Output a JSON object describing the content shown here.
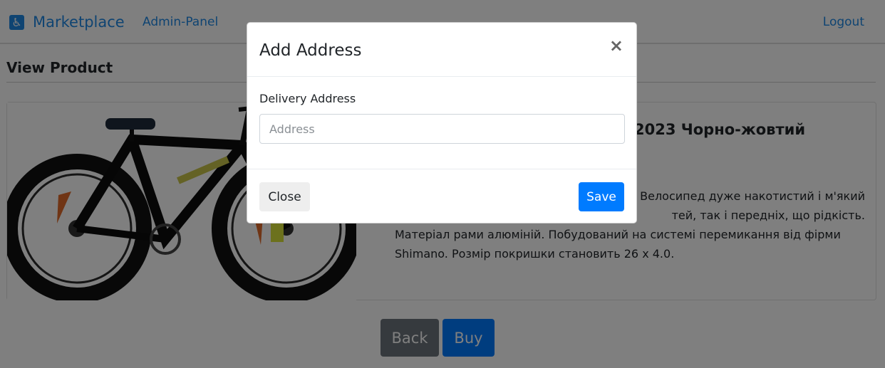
{
  "navbar": {
    "brand_icon": "accessibility-icon",
    "brand": "Marketplace",
    "admin_link": "Admin-Panel",
    "logout_link": "Logout"
  },
  "page": {
    "heading": "View Product"
  },
  "product": {
    "title_visible": "2023 Чорно-жовтий",
    "description_lines": [
      "к. Велосипед дуже накотистий і м'який",
      "тей, так і передніх, що рідкість.",
      "Матеріал рами алюміній. Побудований на системі перемикання від фірми",
      "Shimano. Розмір покришки становить 26 х 4.0."
    ],
    "image_icon": "bicycle-image"
  },
  "actions": {
    "back_label": "Back",
    "buy_label": "Buy"
  },
  "modal": {
    "title": "Add Address",
    "close_x": "×",
    "field_label": "Delivery Address",
    "address_placeholder": "Address",
    "address_value": "",
    "close_label": "Close",
    "save_label": "Save"
  },
  "colors": {
    "link": "#1e88e5",
    "primary": "#007bff",
    "secondary": "#6c757d"
  }
}
